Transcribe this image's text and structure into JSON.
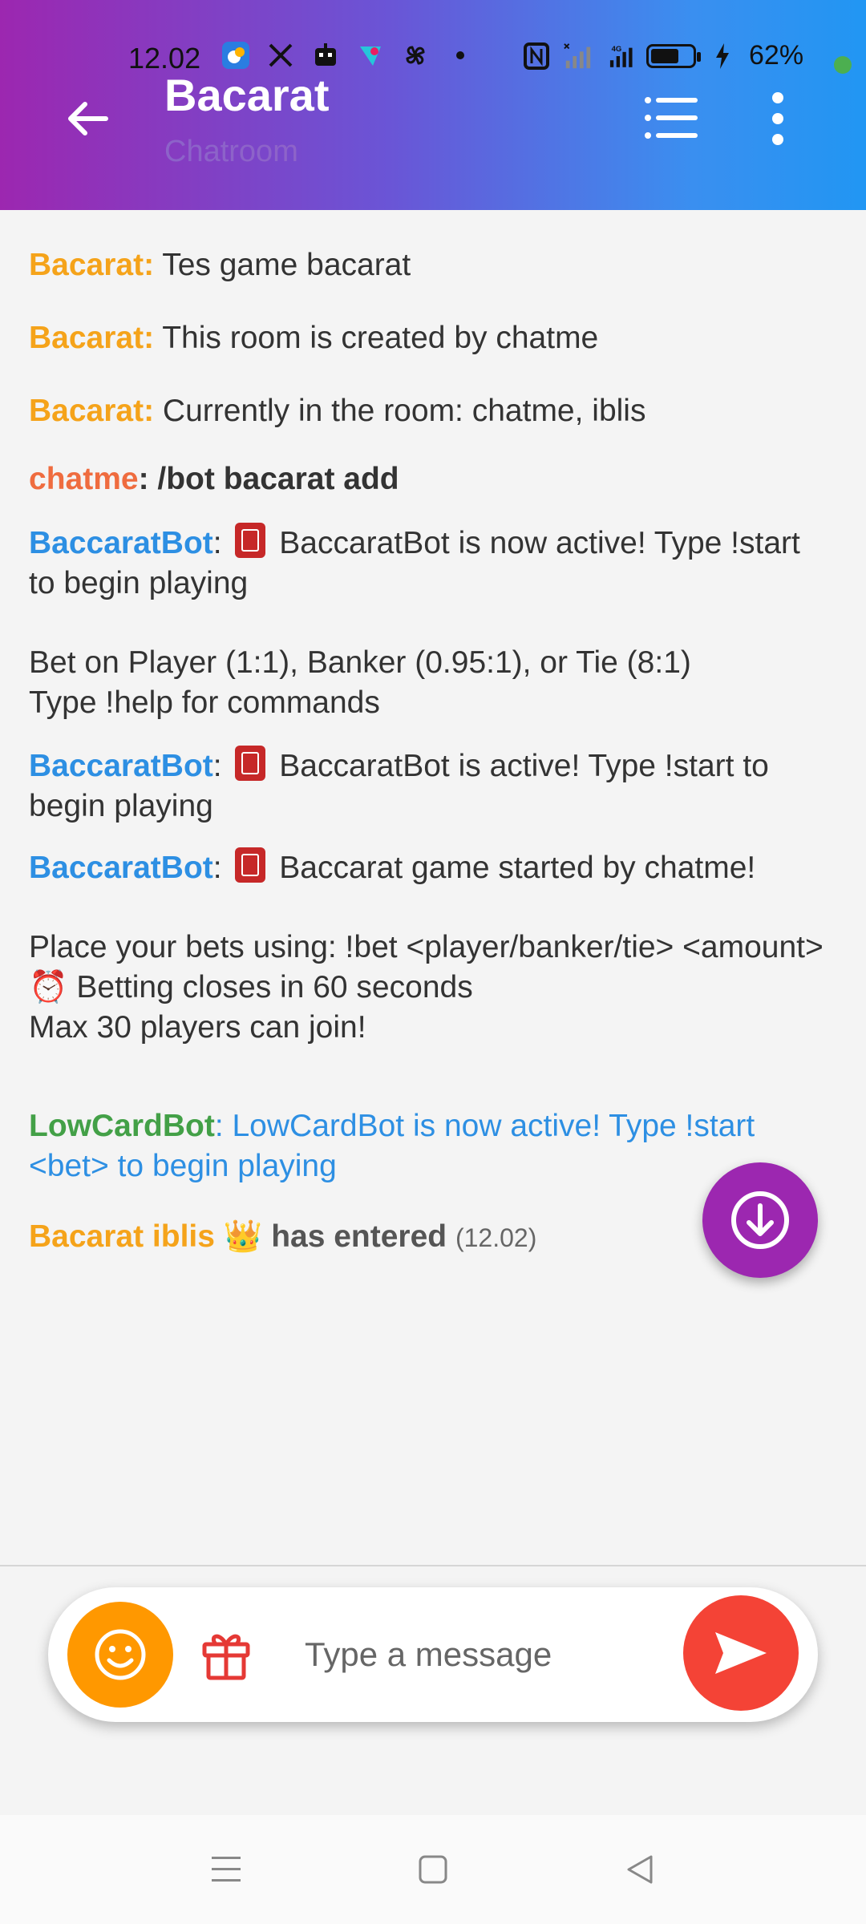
{
  "status": {
    "time": "12.02",
    "battery_pct": "62%",
    "battery_level": 0.62
  },
  "header": {
    "title": "Bacarat",
    "subtitle": "Chatroom"
  },
  "messages": [
    {
      "sender": "Bacarat:",
      "text": " Tes game bacarat"
    },
    {
      "sender": "Bacarat:",
      "text": " This room is created by chatme"
    },
    {
      "sender": "Bacarat:",
      "text": " Currently in the room: chatme, iblis"
    },
    {
      "sender": "chatme",
      "text": ": /bot bacarat add"
    },
    {
      "sender": "BaccaratBot",
      "colon": ":",
      "text": " BaccaratBot is now active! Type !start to begin playing",
      "text2": "Bet on Player (1:1), Banker (0.95:1), or Tie (8:1)",
      "text3": "Type !help for commands"
    },
    {
      "sender": "BaccaratBot",
      "colon": ":",
      "text": " BaccaratBot is active! Type !start to begin playing"
    },
    {
      "sender": "BaccaratBot",
      "colon": ":",
      "text": " Baccarat game started by chatme!",
      "text2": "Place your bets using: !bet <player/banker/tie> <amount>",
      "text3": "⏰ Betting closes in 60 seconds",
      "text4": "Max 30 players can join!"
    },
    {
      "sender": "LowCardBot",
      "colon": ":",
      "text": " LowCardBot is now active! Type !start <bet> to begin playing"
    },
    {
      "sender": "Bacarat iblis",
      "emoji": "👑",
      "text": " has entered ",
      "time": "(12.02)"
    }
  ],
  "input": {
    "placeholder": "Type a message"
  },
  "colors": {
    "header_start": "#9c27b0",
    "header_end": "#2196f3",
    "sender_orange": "#f5a31a",
    "sender_blue": "#2d8fe3",
    "sender_green": "#43a047",
    "emoji_button": "#ff9800",
    "send_button": "#f44336"
  },
  "icons": {
    "back": "arrow-left-icon",
    "list": "list-icon",
    "more": "more-vert-icon",
    "scroll_down": "arrow-down-circle-icon",
    "emoji": "smiley-icon",
    "gift": "gift-icon",
    "send": "send-icon"
  }
}
